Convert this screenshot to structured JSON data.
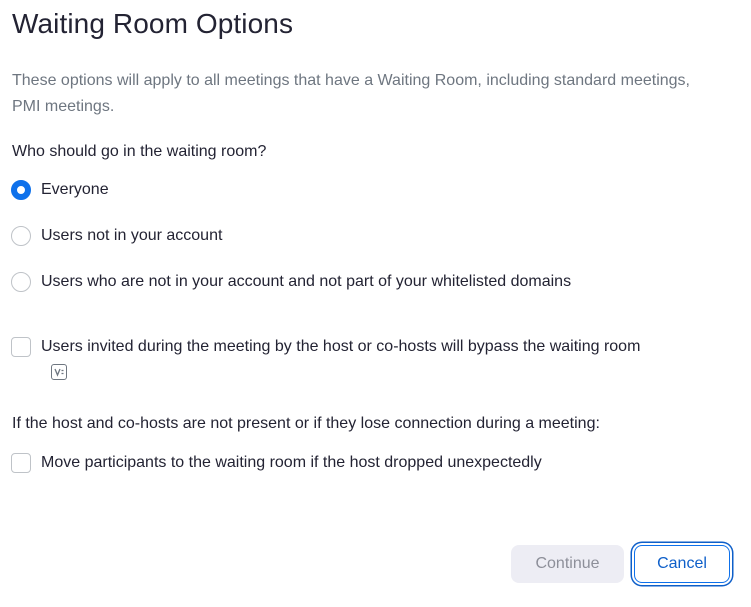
{
  "dialog": {
    "title": "Waiting Room Options",
    "description": "These options will apply to all meetings that have a Waiting Room, including standard meetings, PMI meetings."
  },
  "who_section": {
    "label": "Who should go in the waiting room?",
    "options": [
      {
        "label": "Everyone",
        "selected": true
      },
      {
        "label": "Users not in your account",
        "selected": false
      },
      {
        "label": "Users who are not in your account and not part of your whitelisted domains",
        "selected": false
      }
    ]
  },
  "bypass_option": {
    "label": "Users invited during the meeting by the host or co-hosts will bypass the waiting room",
    "checked": false,
    "badge_icon": "vip-icon"
  },
  "host_section": {
    "label": "If the host and co-hosts are not present or if they lose connection during a meeting:",
    "move_option": {
      "label": "Move participants to the waiting room if the host dropped unexpectedly",
      "checked": false
    }
  },
  "buttons": {
    "continue_label": "Continue",
    "cancel_label": "Cancel"
  },
  "colors": {
    "accent": "#0e71eb",
    "text": "#232333",
    "muted_text": "#6e7680",
    "disabled_button_bg": "#ededf4"
  }
}
